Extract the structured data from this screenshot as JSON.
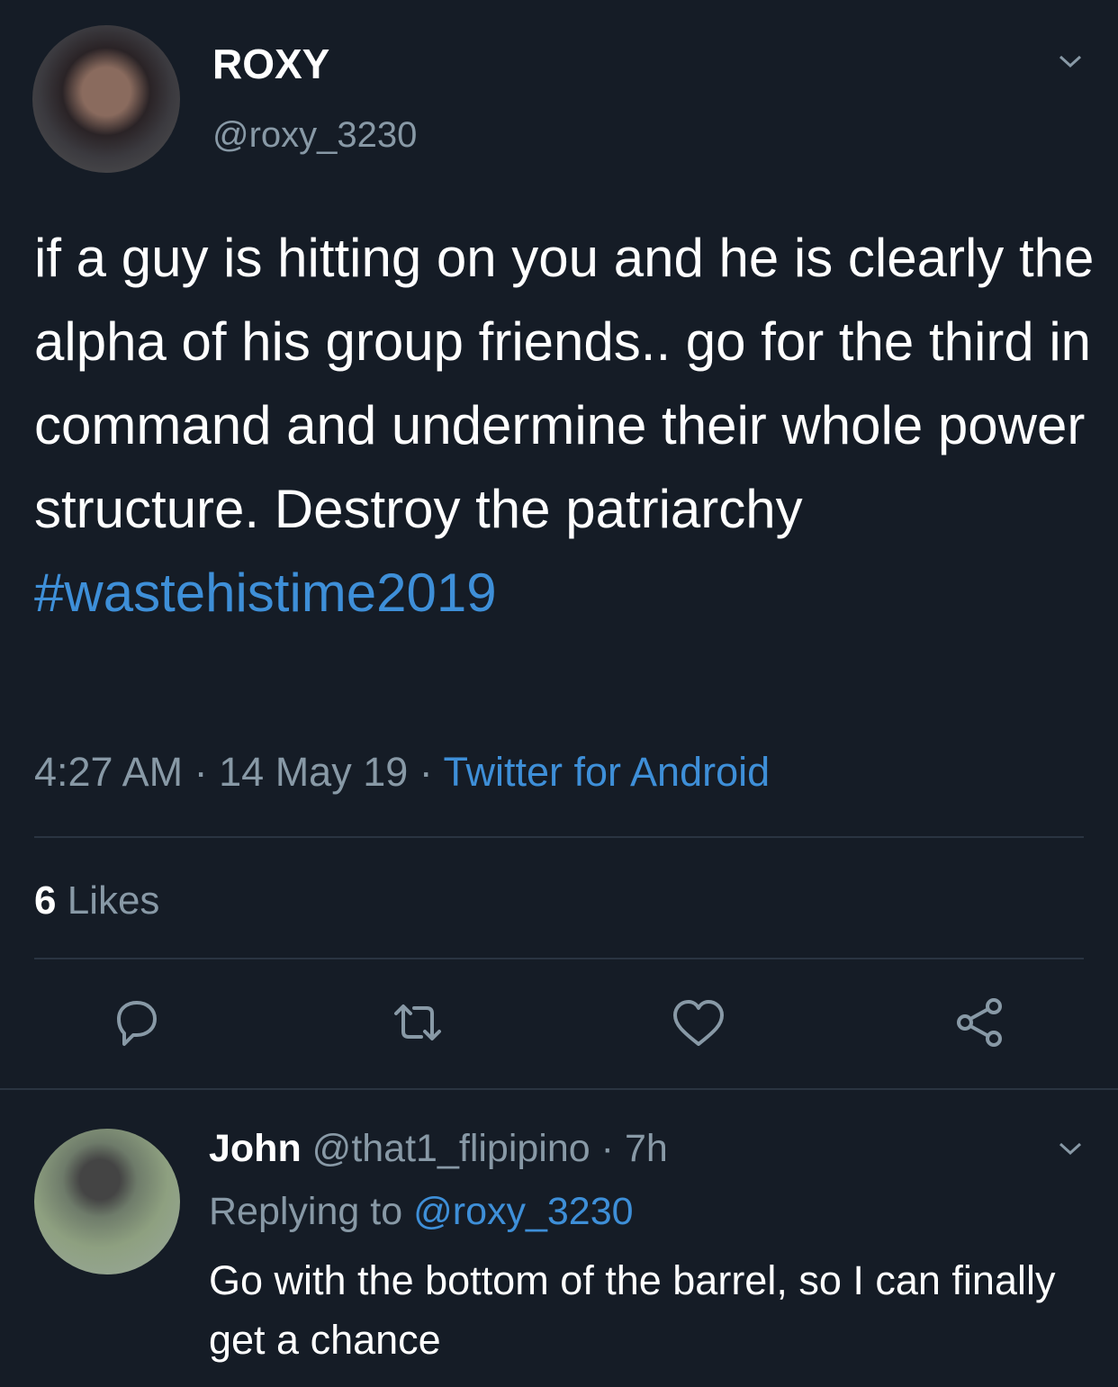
{
  "tweet": {
    "display_name": "ROXY",
    "handle": "@roxy_3230",
    "text": "if a guy is hitting on you and he is clearly the alpha of his group friends.. go for the third in command and undermine their whole power structure. Destroy the patriarchy ",
    "hashtag": "#wastehistime2019",
    "time": "4:27 AM",
    "date": "14 May 19",
    "separator": "·",
    "source": "Twitter for Android",
    "likes_count": "6",
    "likes_label": "Likes"
  },
  "actions": {
    "reply_icon": "reply-icon",
    "retweet_icon": "retweet-icon",
    "like_icon": "heart-icon",
    "share_icon": "share-icon"
  },
  "reply": {
    "name": "John",
    "handle": "@that1_flipipino",
    "separator": "·",
    "age": "7h",
    "replying_label": "Replying to",
    "replying_to": "@roxy_3230",
    "text": "Go with the bottom of the barrel, so I can finally get a chance"
  },
  "colors": {
    "background": "#151c26",
    "link": "#3e8fd8",
    "muted": "#8899a6"
  }
}
